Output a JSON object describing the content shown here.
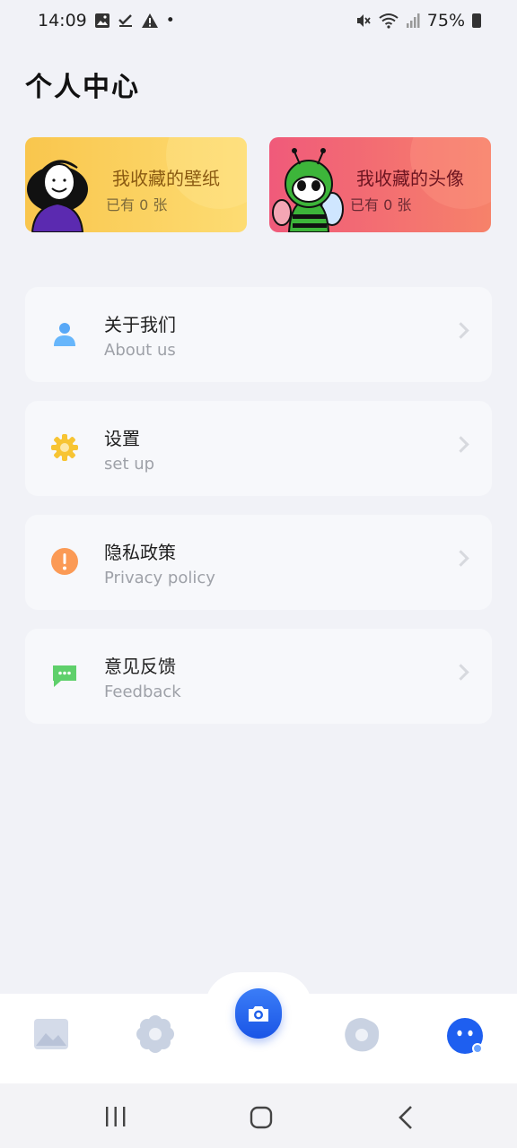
{
  "status_bar": {
    "time": "14:09",
    "battery": "75%",
    "left_icons": [
      "gallery-icon",
      "check-icon",
      "warning-icon",
      "dot"
    ],
    "right_icons": [
      "mute-icon",
      "wifi-icon",
      "signal-icon",
      "battery-icon"
    ]
  },
  "page": {
    "title": "个人中心"
  },
  "favorites": [
    {
      "title": "我收藏的壁纸",
      "count": "已有 0 张"
    },
    {
      "title": "我收藏的头像",
      "count": "已有 0 张"
    }
  ],
  "menu": [
    {
      "title": "关于我们",
      "subtitle": "About us",
      "icon": "user-icon"
    },
    {
      "title": "设置",
      "subtitle": "set up",
      "icon": "gear-icon"
    },
    {
      "title": "隐私政策",
      "subtitle": "Privacy policy",
      "icon": "exclamation-icon"
    },
    {
      "title": "意见反馈",
      "subtitle": "Feedback",
      "icon": "chat-bubble-icon"
    }
  ],
  "bottom_nav": {
    "items": [
      "image-icon",
      "flower-icon",
      "camera-icon",
      "egg-icon",
      "profile-icon"
    ],
    "active": "profile-icon",
    "accent": "#1e5ff0"
  }
}
